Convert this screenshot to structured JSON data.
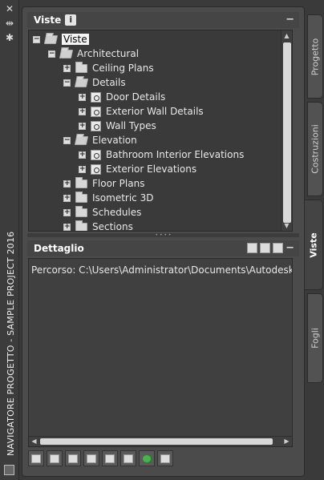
{
  "palette": {
    "title": "NAVIGATORE PROGETTO - SAMPLE PROJECT 2016"
  },
  "views": {
    "header": "Viste",
    "info_badge": "i",
    "collapse": "−",
    "tree": [
      {
        "label": "Viste",
        "level": 0,
        "state": "expanded",
        "icon": "folder-open-icon",
        "selected": true
      },
      {
        "label": "Architectural",
        "level": 1,
        "state": "expanded",
        "icon": "folder-open-icon"
      },
      {
        "label": "Ceiling Plans",
        "level": 2,
        "state": "collapsed",
        "icon": "folder-icon"
      },
      {
        "label": "Details",
        "level": 2,
        "state": "expanded",
        "icon": "folder-open-icon"
      },
      {
        "label": "Door Details",
        "level": 3,
        "state": "collapsed",
        "icon": "detail-view-icon"
      },
      {
        "label": "Exterior Wall Details",
        "level": 3,
        "state": "collapsed",
        "icon": "detail-view-icon"
      },
      {
        "label": "Wall Types",
        "level": 3,
        "state": "collapsed",
        "icon": "detail-view-icon"
      },
      {
        "label": "Elevation",
        "level": 2,
        "state": "expanded",
        "icon": "folder-open-icon"
      },
      {
        "label": "Bathroom Interior Elevations",
        "level": 3,
        "state": "collapsed",
        "icon": "elevation-view-icon"
      },
      {
        "label": "Exterior Elevations",
        "level": 3,
        "state": "collapsed",
        "icon": "elevation-view-icon"
      },
      {
        "label": "Floor Plans",
        "level": 2,
        "state": "collapsed",
        "icon": "folder-icon"
      },
      {
        "label": "Isometric 3D",
        "level": 2,
        "state": "collapsed",
        "icon": "folder-icon"
      },
      {
        "label": "Schedules",
        "level": 2,
        "state": "collapsed",
        "icon": "folder-icon"
      },
      {
        "label": "Sections",
        "level": 2,
        "state": "collapsed",
        "icon": "folder-icon"
      }
    ]
  },
  "detail": {
    "header": "Dettaglio",
    "collapse": "−",
    "path_text": "Percorso: C:\\Users\\Administrator\\Documents\\Autodesk\\Progetti"
  },
  "toolbar": {
    "buttons": [
      "new-view-icon",
      "open-icon",
      "regenerate-icon",
      "clipboard-icon",
      "repath-icon",
      "table-icon",
      "refresh-icon",
      "close-project-icon"
    ]
  },
  "tabs": [
    {
      "label": "Progetto",
      "active": false
    },
    {
      "label": "Costruzioni",
      "active": false
    },
    {
      "label": "Viste",
      "active": true
    },
    {
      "label": "Fogli",
      "active": false
    }
  ]
}
